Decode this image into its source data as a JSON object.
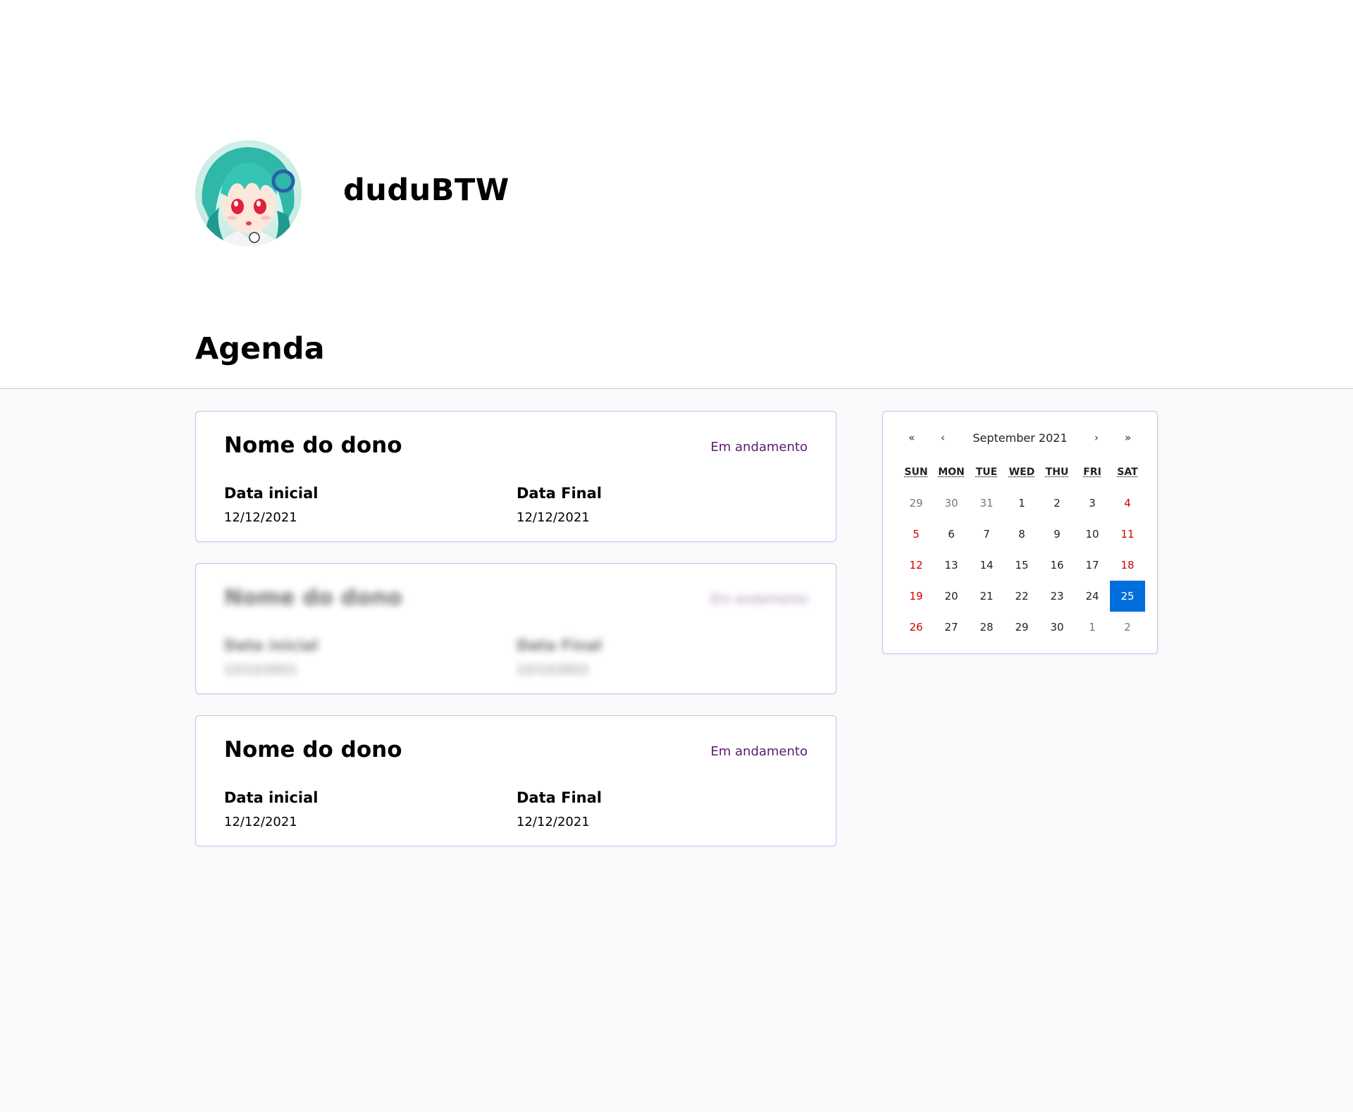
{
  "profile": {
    "username": "duduBTW",
    "avatar": "avatar-image"
  },
  "agenda": {
    "title": "Agenda",
    "cards": [
      {
        "owner": "Nome do dono",
        "status": "Em andamento",
        "start_label": "Data inicial",
        "start_value": "12/12/2021",
        "end_label": "Data Final",
        "end_value": "12/12/2021",
        "blurred": false
      },
      {
        "owner": "Nome do dono",
        "status": "Em andamento",
        "start_label": "Data inicial",
        "start_value": "12/12/2021",
        "end_label": "Data Final",
        "end_value": "12/12/2021",
        "blurred": true
      },
      {
        "owner": "Nome do dono",
        "status": "Em andamento",
        "start_label": "Data inicial",
        "start_value": "12/12/2021",
        "end_label": "Data Final",
        "end_value": "12/12/2021",
        "blurred": false
      }
    ]
  },
  "calendar": {
    "month_label": "September 2021",
    "prev_year": "«",
    "prev_month": "‹",
    "next_month": "›",
    "next_year": "»",
    "weekdays": [
      "SUN",
      "MON",
      "TUE",
      "WED",
      "THU",
      "FRI",
      "SAT"
    ],
    "days": [
      {
        "d": "29",
        "other": true
      },
      {
        "d": "30",
        "other": true
      },
      {
        "d": "31",
        "other": true
      },
      {
        "d": "1"
      },
      {
        "d": "2"
      },
      {
        "d": "3"
      },
      {
        "d": "4",
        "weekend": true
      },
      {
        "d": "5",
        "weekend": true
      },
      {
        "d": "6"
      },
      {
        "d": "7"
      },
      {
        "d": "8"
      },
      {
        "d": "9"
      },
      {
        "d": "10"
      },
      {
        "d": "11",
        "weekend": true
      },
      {
        "d": "12",
        "weekend": true
      },
      {
        "d": "13"
      },
      {
        "d": "14"
      },
      {
        "d": "15"
      },
      {
        "d": "16"
      },
      {
        "d": "17"
      },
      {
        "d": "18",
        "weekend": true
      },
      {
        "d": "19",
        "weekend": true
      },
      {
        "d": "20"
      },
      {
        "d": "21"
      },
      {
        "d": "22"
      },
      {
        "d": "23"
      },
      {
        "d": "24"
      },
      {
        "d": "25",
        "selected": true
      },
      {
        "d": "26",
        "weekend": true
      },
      {
        "d": "27"
      },
      {
        "d": "28"
      },
      {
        "d": "29"
      },
      {
        "d": "30"
      },
      {
        "d": "1",
        "other": true
      },
      {
        "d": "2",
        "other": true
      }
    ],
    "colors": {
      "selected_bg": "#006edc",
      "weekend": "#d10000",
      "status": "#5b1a6e",
      "border": "#c9c3ec"
    }
  }
}
